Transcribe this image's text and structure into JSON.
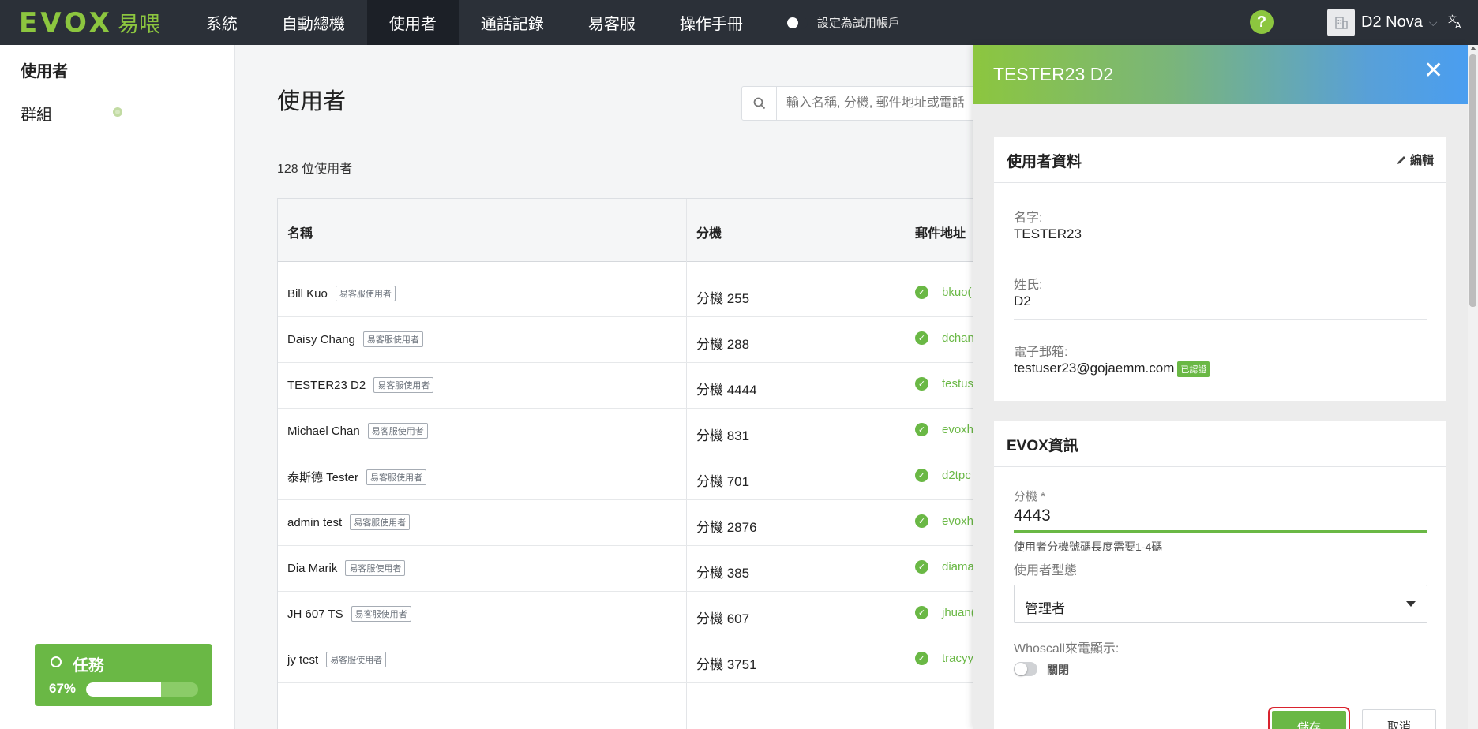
{
  "topnav": {
    "logo_text": "EVOX",
    "logo_cn": "易喂",
    "items": [
      "系統",
      "自動總機",
      "使用者",
      "通話記錄",
      "易客服",
      "操作手冊"
    ],
    "active_index": 2,
    "trial_label": "設定為試用帳戶",
    "help_label": "?",
    "account_name": "D2 Nova",
    "account_icon": "building-icon",
    "lang_icon": "translate-icon"
  },
  "sidebar": {
    "items": [
      "使用者",
      "群組"
    ],
    "task": {
      "title": "任務",
      "percent_label": "67%",
      "progress": 0.67
    }
  },
  "main": {
    "title": "使用者",
    "search_placeholder": "輸入名稱, 分機, 郵件地址或電話",
    "count": "128 位使用者",
    "columns": [
      "名稱",
      "分機",
      "郵件地址"
    ],
    "rows": [
      {
        "name": "Bill Kuo",
        "tag": "易客服使用者",
        "ext": "分機 255",
        "email": "bkuo("
      },
      {
        "name": "Daisy Chang",
        "tag": "易客服使用者",
        "ext": "分機 288",
        "email": "dchan"
      },
      {
        "name": "TESTER23 D2",
        "tag": "易客服使用者",
        "ext": "分機 4444",
        "email": "testus"
      },
      {
        "name": "Michael Chan",
        "tag": "易客服使用者",
        "ext": "分機 831",
        "email": "evoxh"
      },
      {
        "name": "泰斯德 Tester",
        "tag": "易客服使用者",
        "ext": "分機 701",
        "email": "d2tpc"
      },
      {
        "name": "admin test",
        "tag": "易客服使用者",
        "ext": "分機 2876",
        "email": "evoxh"
      },
      {
        "name": "Dia Marik",
        "tag": "易客服使用者",
        "ext": "分機 385",
        "email": "diama"
      },
      {
        "name": "JH 607 TS",
        "tag": "易客服使用者",
        "ext": "分機 607",
        "email": "jhuan("
      },
      {
        "name": "jy test",
        "tag": "易客服使用者",
        "ext": "分機 3751",
        "email": "tracyy"
      }
    ]
  },
  "panel": {
    "title": "TESTER23 D2",
    "profile": {
      "title": "使用者資料",
      "edit_label": "編輯",
      "first_name_label": "名字:",
      "first_name": "TESTER23",
      "last_name_label": "姓氏:",
      "last_name": "D2",
      "email_label": "電子郵箱:",
      "email": "testuser23@gojaemm.com",
      "verified_badge": "已認證"
    },
    "evox": {
      "title": "EVOX資訊",
      "ext_label": "分機 *",
      "ext_value": "4443",
      "ext_hint": "使用者分機號碼長度需要1-4碼",
      "type_label": "使用者型態",
      "type_value": "管理者",
      "whoscall_label": "Whoscall來電顯示:",
      "whoscall_state": "關閉",
      "save_label": "儲存",
      "cancel_label": "取消"
    }
  },
  "colors": {
    "brand_green": "#8cc63f",
    "accent_green": "#6ab845",
    "nav_bg": "#2b3038",
    "highlight_red": "#d9232e"
  }
}
